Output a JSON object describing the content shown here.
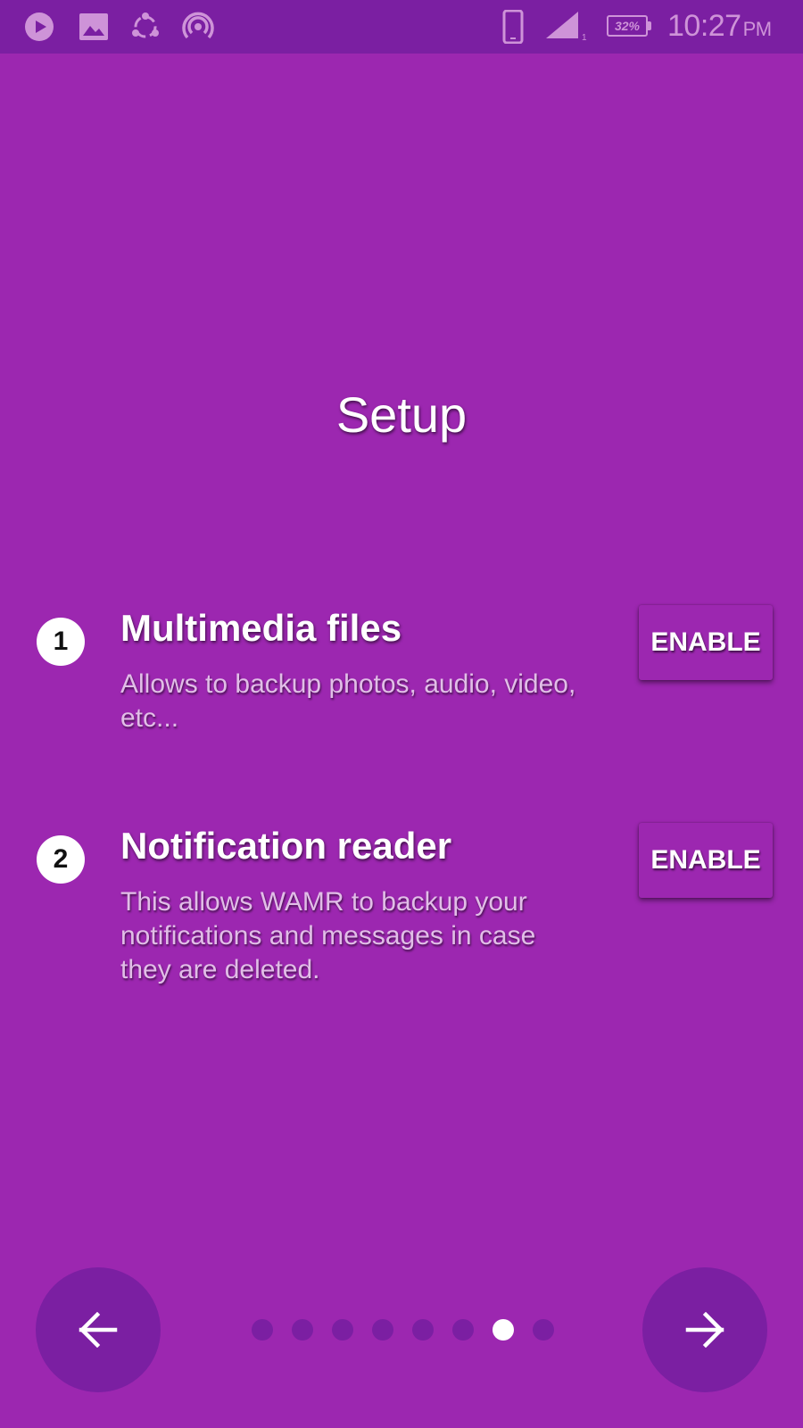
{
  "status_bar": {
    "icons": [
      "play-store-icon",
      "gallery-icon",
      "shareit-icon",
      "hotspot-icon",
      "phone-icon",
      "signal-icon"
    ],
    "signal_sim": "1",
    "battery": "32%",
    "time": "10:27",
    "ampm": "PM"
  },
  "page": {
    "title": "Setup"
  },
  "steps": [
    {
      "number": "1",
      "title": "Multimedia files",
      "description": "Allows to backup photos, audio, video, etc...",
      "button_label": "ENABLE"
    },
    {
      "number": "2",
      "title": "Notification reader",
      "description": "This allows WAMR to backup your notifications and messages in case they are deleted.",
      "button_label": "ENABLE"
    }
  ],
  "navigation": {
    "back_icon": "arrow-left-icon",
    "next_icon": "arrow-right-icon",
    "page_count": 8,
    "active_page": 7
  },
  "colors": {
    "background": "#9c27b0",
    "status_bar": "#7b1fa2",
    "nav_button": "#7b1fa2",
    "dot_inactive": "#7b1fa2",
    "dot_active": "#ffffff",
    "status_icons": "#ce93d8"
  }
}
